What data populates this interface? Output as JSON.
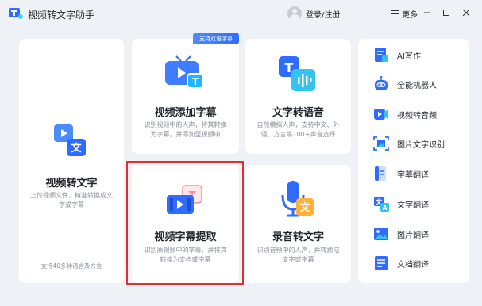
{
  "app": {
    "title": "视频转文字助手",
    "login": "登录/注册",
    "more": "更多"
  },
  "badge": "支持双语字幕",
  "cards": {
    "video_to_text": {
      "title": "视频转文字",
      "desc": "上传视频文件，精准转换成文字或字幕",
      "footer": "支持40多种语言及方言"
    },
    "add_subtitles": {
      "title": "视频添加字幕",
      "desc": "识别视频中的人声，将其转换为字幕，并添加至视频中"
    },
    "text_to_speech": {
      "title": "文字转语音",
      "desc": "自然模拟人声，支持中文、外语、方言等100+声音选择"
    },
    "extract_subtitles": {
      "title": "视频字幕提取",
      "desc": "识别原视频中的字幕，并将其转换为文档或字幕"
    },
    "audio_to_text": {
      "title": "录音转文字",
      "desc": "识别音频中的人声，并转换成文字或字幕"
    }
  },
  "side": [
    {
      "label": "AI写作",
      "icon": "ai-writing-icon"
    },
    {
      "label": "全能机器人",
      "icon": "robot-icon"
    },
    {
      "label": "视频转音频",
      "icon": "video-to-audio-icon"
    },
    {
      "label": "图片文字识别",
      "icon": "image-ocr-icon"
    },
    {
      "label": "字幕翻译",
      "icon": "subtitle-translate-icon"
    },
    {
      "label": "文字翻译",
      "icon": "text-translate-icon"
    },
    {
      "label": "图片翻译",
      "icon": "image-translate-icon"
    },
    {
      "label": "文档翻译",
      "icon": "document-translate-icon"
    }
  ],
  "colors": {
    "accent": "#2f6bff",
    "highlight_border": "#e12f2f",
    "background": "#eef1f6"
  }
}
